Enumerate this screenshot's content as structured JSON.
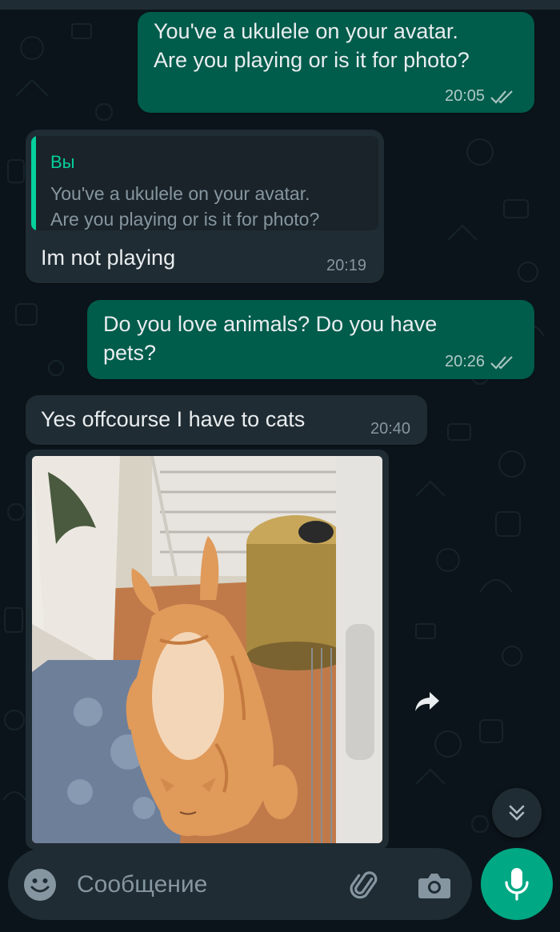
{
  "messages": [
    {
      "direction": "outgoing",
      "text": "You've a ukulele on your avatar.\nAre you playing or is it for photo?",
      "time": "20:05",
      "status": "read"
    },
    {
      "direction": "incoming",
      "quoted": {
        "author": "Вы",
        "text": "You've a ukulele on your avatar.\nAre you playing or is it for photo?"
      },
      "text": "Im not playing",
      "time": "20:19"
    },
    {
      "direction": "outgoing",
      "text": "Do you love animals? Do you have\npets?",
      "time": "20:26",
      "status": "read"
    },
    {
      "direction": "incoming",
      "text": "Yes offcourse I have to cats",
      "time": "20:40"
    },
    {
      "direction": "incoming",
      "type": "image",
      "image": "ginger-cat-photo"
    }
  ],
  "composer": {
    "placeholder": "Сообщение"
  },
  "icons": {
    "read_receipt": "double-check-icon",
    "forward": "forward-icon",
    "scroll_down": "double-chevron-down-icon",
    "emoji": "emoji-icon",
    "attach": "paperclip-icon",
    "camera": "camera-icon",
    "mic": "microphone-icon"
  },
  "colors": {
    "background": "#0b141a",
    "outgoing_bubble": "#005c4b",
    "incoming_bubble": "#202c33",
    "accent": "#00a884",
    "quote_accent": "#06cf9c"
  }
}
